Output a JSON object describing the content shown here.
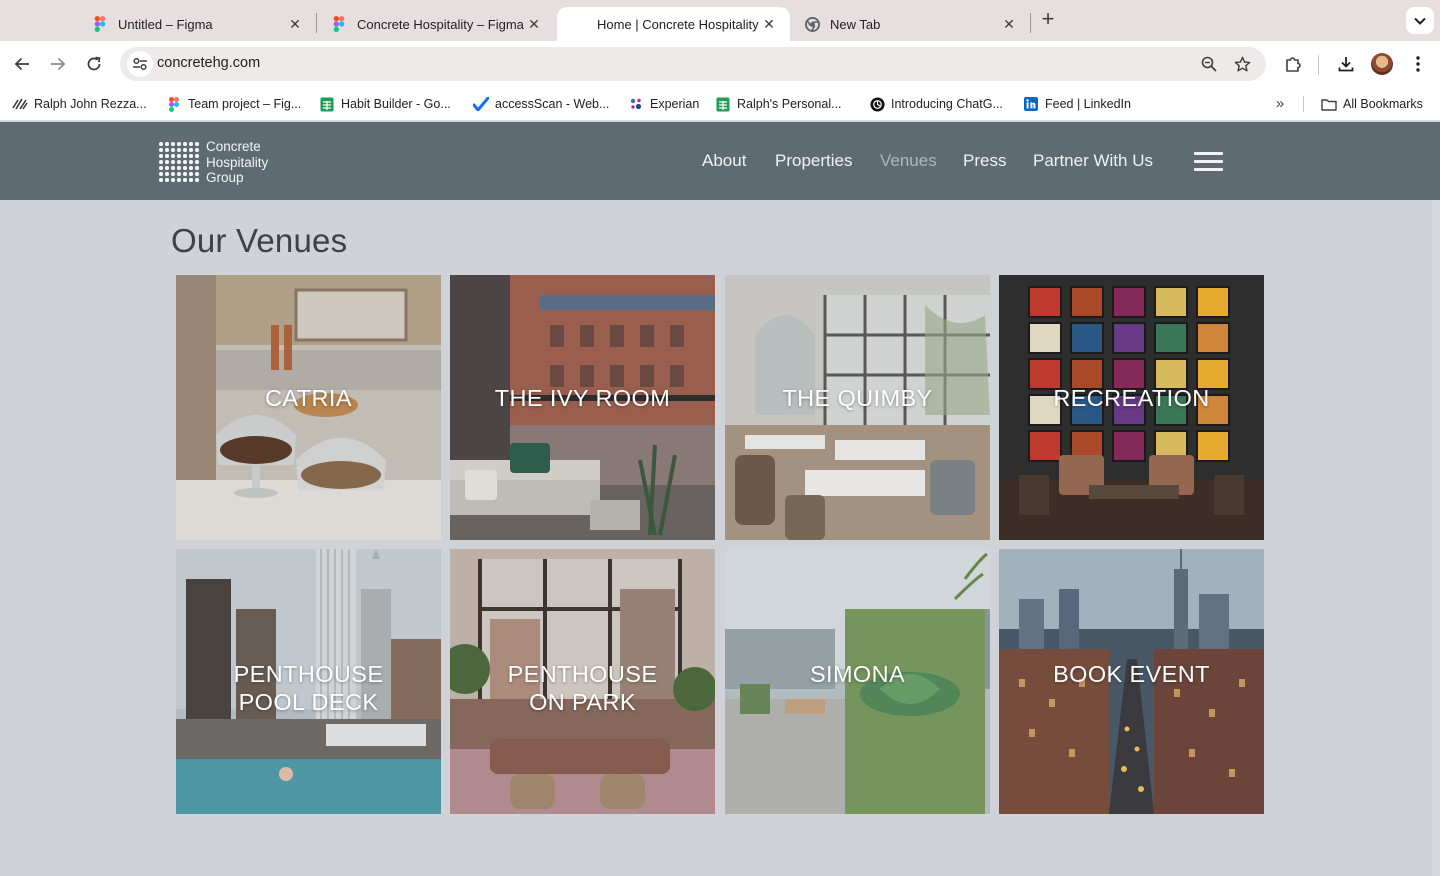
{
  "browser": {
    "tabs": [
      {
        "title": "Untitled – Figma",
        "icon": "figma-icon",
        "active": false
      },
      {
        "title": "Concrete Hospitality – Figma",
        "icon": "figma-icon",
        "active": false
      },
      {
        "title": "Home | Concrete Hospitality",
        "icon": "blank-page-icon",
        "active": true
      },
      {
        "title": "New Tab",
        "icon": "chrome-icon",
        "active": false
      }
    ],
    "close_glyph": "✕",
    "new_tab_glyph": "+",
    "url": "concretehg.com",
    "bookmarks": [
      {
        "label": "Ralph John Rezza...",
        "icon": "squiggle-logo-icon"
      },
      {
        "label": "Team project – Fig...",
        "icon": "figma-icon"
      },
      {
        "label": "Habit Builder - Go...",
        "icon": "sheets-icon"
      },
      {
        "label": "accessScan - Web...",
        "icon": "accessibe-check-icon"
      },
      {
        "label": "Experian",
        "icon": "experian-icon"
      },
      {
        "label": "Ralph's Personal...",
        "icon": "sheets-icon"
      },
      {
        "label": "Introducing ChatG...",
        "icon": "openai-icon"
      },
      {
        "label": "Feed | LinkedIn",
        "icon": "linkedin-icon"
      }
    ],
    "bookmarks_overflow_glyph": "»",
    "all_bookmarks": "All Bookmarks"
  },
  "site": {
    "logo": [
      "Concrete",
      "Hospitality",
      "Group"
    ],
    "nav": [
      "About",
      "Properties",
      "Venues",
      "Press",
      "Partner With Us"
    ],
    "current_nav": "Venues",
    "menu_icon": "hamburger-menu-icon"
  },
  "page": {
    "title": "Our Venues",
    "venues": [
      {
        "lines": [
          "CATRIA"
        ]
      },
      {
        "lines": [
          "THE IVY ROOM"
        ]
      },
      {
        "lines": [
          "THE QUIMBY"
        ]
      },
      {
        "lines": [
          "RECREATION"
        ]
      },
      {
        "lines": [
          "PENTHOUSE",
          "POOL DECK"
        ]
      },
      {
        "lines": [
          "PENTHOUSE",
          "ON PARK"
        ]
      },
      {
        "lines": [
          "SIMONA"
        ]
      },
      {
        "lines": [
          "BOOK EVENT"
        ]
      }
    ]
  },
  "colors": {
    "tab_strip": "#e7dfdf",
    "header": "#5f6b73",
    "page_bg": "#cfd3d7",
    "nav_current": "#aeb6bd"
  }
}
